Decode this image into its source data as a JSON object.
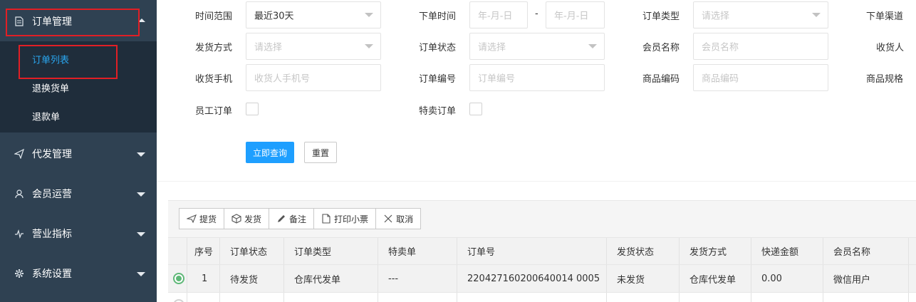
{
  "sidebar": {
    "menus": [
      {
        "label": "订单管理",
        "icon": "document-icon",
        "expanded": true
      },
      {
        "label": "代发管理",
        "icon": "send-icon"
      },
      {
        "label": "会员运营",
        "icon": "user-icon"
      },
      {
        "label": "营业指标",
        "icon": "pulse-icon"
      },
      {
        "label": "系统设置",
        "icon": "gear-icon"
      }
    ],
    "sub_items": [
      {
        "label": "订单列表",
        "active": true
      },
      {
        "label": "退换货单"
      },
      {
        "label": "退款单"
      }
    ]
  },
  "form": {
    "time_range_label": "时间范围",
    "time_range_value": "最近30天",
    "order_time_label": "下单时间",
    "date_start_placeholder": "年-月-日",
    "date_sep": "-",
    "date_end_placeholder": "年-月-日",
    "order_type_label": "订单类型",
    "order_type_placeholder": "请选择",
    "order_channel_label": "下单渠道",
    "ship_method_label": "发货方式",
    "ship_method_placeholder": "请选择",
    "order_status_label": "订单状态",
    "order_status_placeholder": "请选择",
    "member_name_label": "会员名称",
    "member_name_placeholder": "会员名称",
    "receiver_label": "收货人",
    "receiver_phone_label": "收货手机",
    "receiver_phone_placeholder": "收货人手机号",
    "order_no_label": "订单编号",
    "order_no_placeholder": "订单编号",
    "goods_code_label": "商品编码",
    "goods_code_placeholder": "商品编码",
    "goods_spec_label": "商品规格",
    "staff_order_label": "员工订单",
    "special_order_label": "特卖订单",
    "search_button": "立即查询",
    "reset_button": "重置"
  },
  "toolbar": {
    "pickup": "提货",
    "ship": "发货",
    "remark": "备注",
    "print": "打印小票",
    "cancel": "取消"
  },
  "table": {
    "headers": [
      "序号",
      "订单状态",
      "订单类型",
      "特卖单",
      "订单号",
      "发货状态",
      "发货方式",
      "快递金额",
      "会员名称"
    ],
    "rows": [
      {
        "index": "1",
        "status": "待发货",
        "type": "仓库代发单",
        "special": "---",
        "order_no": "220427160200640014 0005",
        "ship_status": "未发货",
        "ship_method": "仓库代发单",
        "express_fee": "0.00",
        "member": "微信用户",
        "selected": true
      }
    ]
  },
  "colors": {
    "sidebar_bg": "#2f4152",
    "submenu_bg": "#1f2d3b",
    "active_sub": "#2aa7f0",
    "primary": "#1e9fff",
    "radio_on": "#5fb878",
    "highlight_box": "#e11f25"
  }
}
